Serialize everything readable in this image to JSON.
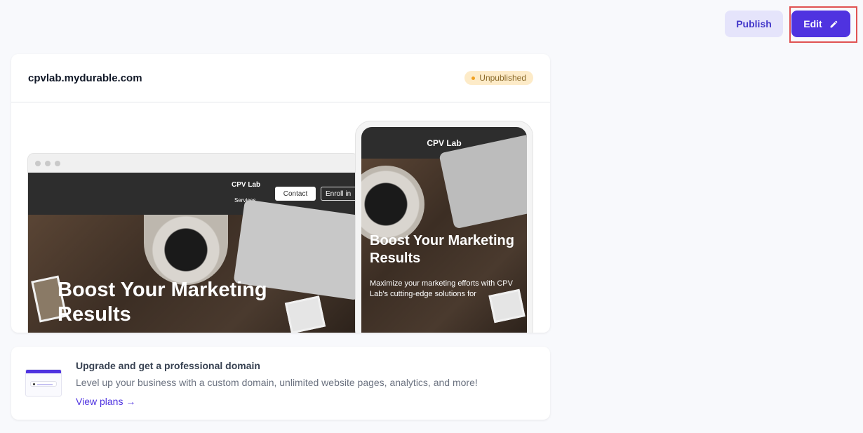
{
  "toolbar": {
    "publish_label": "Publish",
    "edit_label": "Edit",
    "edit_icon": "pencil-icon"
  },
  "site_card": {
    "domain": "cpvlab.mydurable.com",
    "status_badge": "Unpublished",
    "desktop_preview": {
      "brand": "CPV Lab",
      "nav_link": "Services",
      "contact_button": "Contact",
      "enroll_button": "Enroll in",
      "hero_title": "Boost Your Marketing Results"
    },
    "mobile_preview": {
      "brand": "CPV Lab",
      "menu_icon": "hamburger-menu-icon",
      "hero_title": "Boost Your Marketing Results",
      "hero_subtitle": "Maximize your marketing efforts with CPV Lab's cutting-edge solutions for"
    }
  },
  "upgrade": {
    "title": "Upgrade and get a professional domain",
    "description": "Level up your business with a custom domain, unlimited website pages, analytics, and more!",
    "link": "View plans →"
  },
  "colors": {
    "accent": "#4f33e0",
    "publish_bg": "#e5e4fb",
    "badge_bg": "#fdebc8",
    "highlight": "#e05252"
  }
}
